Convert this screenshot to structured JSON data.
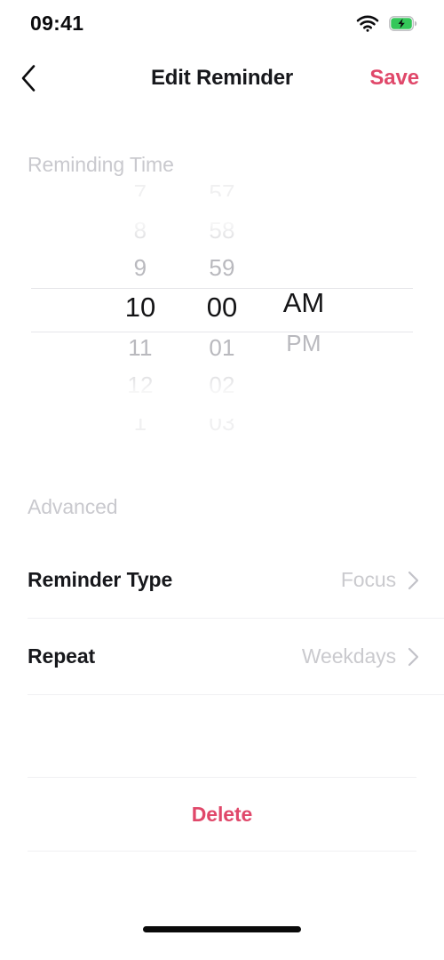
{
  "status_bar": {
    "time": "09:41",
    "wifi_icon": "wifi-icon",
    "battery_icon": "battery-charging-icon",
    "battery_color": "#34C759"
  },
  "nav": {
    "back_icon": "chevron-left-icon",
    "title": "Edit Reminder",
    "save_label": "Save",
    "accent_color": "#E0486A"
  },
  "reminding_time": {
    "section_label": "Reminding Time",
    "selected_hour": "10",
    "selected_minute": "00",
    "selected_period": "AM",
    "hours": [
      "7",
      "8",
      "9",
      "10",
      "11",
      "12",
      "1"
    ],
    "minutes": [
      "57",
      "58",
      "59",
      "00",
      "01",
      "02",
      "03"
    ],
    "periods": [
      "AM",
      "PM"
    ]
  },
  "advanced": {
    "section_label": "Advanced",
    "rows": [
      {
        "label": "Reminder Type",
        "value": "Focus",
        "chevron": "chevron-right-icon"
      },
      {
        "label": "Repeat",
        "value": "Weekdays",
        "chevron": "chevron-right-icon"
      }
    ]
  },
  "delete": {
    "label": "Delete",
    "color": "#E0486A"
  }
}
